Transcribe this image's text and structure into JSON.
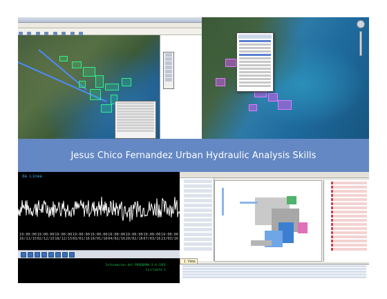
{
  "banner": {
    "title": "Jesus Chico Fernandez  Urban Hydraulic Analysis Skills"
  },
  "series_panel": {
    "header": "de Linea",
    "timestamps": [
      {
        "time": "19:00:00",
        "date": "16/11/15"
      },
      {
        "time": "19:00:00",
        "date": "02/12/15"
      },
      {
        "time": "19:00:00",
        "date": "18/12/15"
      },
      {
        "time": "19:00:00",
        "date": "03/01/16"
      },
      {
        "time": "19:00:00",
        "date": "19/01/16"
      },
      {
        "time": "19:00:00",
        "date": "04/02/16"
      },
      {
        "time": "19:00:00",
        "date": "20/02/16"
      },
      {
        "time": "19:00:00",
        "date": "07/03/16"
      },
      {
        "time": "19:00:00",
        "date": "23/03/16"
      }
    ],
    "status": {
      "line1": "Informacion del PROGRAMA 2.0 CHCE",
      "line2": "Corriente 1"
    }
  },
  "arcgis_panel": {
    "task_tag": "1. Vista"
  },
  "icons": {
    "earth_nav": "compass-icon",
    "earth_zoom": "zoom-slider-icon"
  },
  "colors": {
    "banner": "#6488c3",
    "series_trace": "#ffffff",
    "gis_parcels": "#2ef28c",
    "earth_blocks": "#e07cff"
  }
}
